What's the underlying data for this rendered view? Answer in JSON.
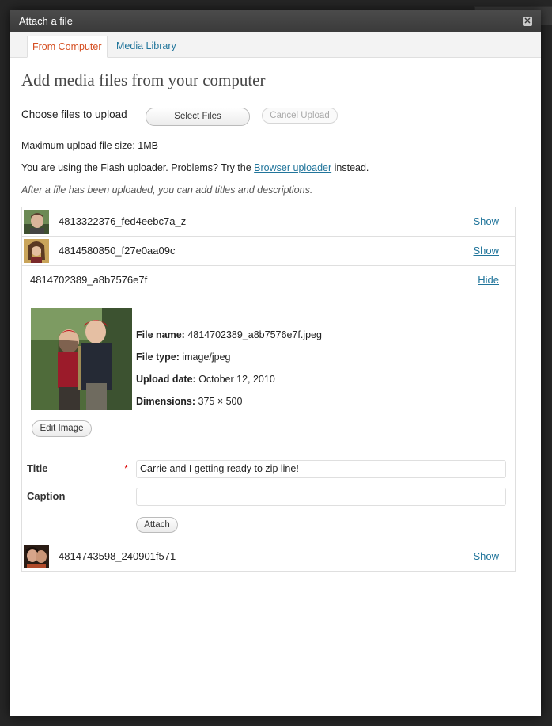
{
  "dialog": {
    "title": "Attach a file"
  },
  "tabs": [
    {
      "label": "From Computer",
      "active": true
    },
    {
      "label": "Media Library",
      "active": false
    }
  ],
  "heading": "Add media files from your computer",
  "upload": {
    "choose_label": "Choose files to upload",
    "select_button": "Select Files",
    "cancel_button": "Cancel Upload",
    "max_size": "Maximum upload file size: 1MB",
    "flash_notice_pre": "You are using the Flash uploader. Problems? Try the ",
    "flash_notice_link": "Browser uploader",
    "flash_notice_post": " instead.",
    "hint": "After a file has been uploaded, you can add titles and descriptions."
  },
  "files": [
    {
      "name": "4813322376_fed4eebc7a_z",
      "toggle": "Show"
    },
    {
      "name": "4814580850_f27e0aa09c",
      "toggle": "Show"
    },
    {
      "name": "4814702389_a8b7576e7f",
      "toggle": "Hide"
    },
    {
      "name": "4814743598_240901f571",
      "toggle": "Show"
    }
  ],
  "expanded": {
    "file_name_label": "File name:",
    "file_name": "4814702389_a8b7576e7f.jpeg",
    "file_type_label": "File type:",
    "file_type": "image/jpeg",
    "upload_date_label": "Upload date:",
    "upload_date": "October 12, 2010",
    "dimensions_label": "Dimensions:",
    "dimensions": "375 × 500",
    "edit_button": "Edit Image",
    "title_label": "Title",
    "required_mark": "*",
    "title_value": "Carrie and I getting ready to zip line!",
    "caption_label": "Caption",
    "caption_value": "",
    "attach_button": "Attach"
  },
  "colors": {
    "accent_tab": "#d54e21",
    "link": "#21759b",
    "titlebar": "#464646"
  }
}
